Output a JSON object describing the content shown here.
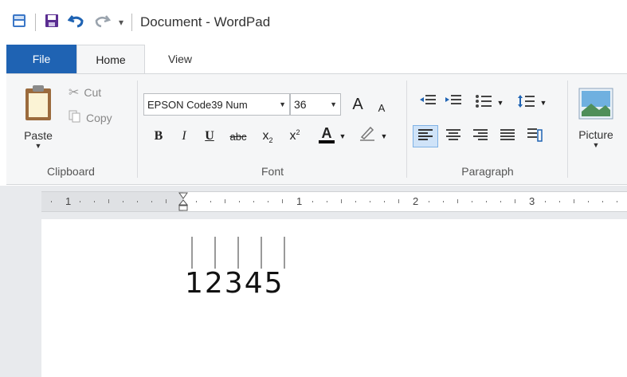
{
  "window": {
    "title": "Document - WordPad"
  },
  "tabs": {
    "file": "File",
    "home": "Home",
    "view": "View"
  },
  "clipboard": {
    "paste": "Paste",
    "cut": "Cut",
    "copy": "Copy",
    "group_label": "Clipboard"
  },
  "font": {
    "family": "EPSON Code39 Num",
    "size": "36",
    "group_label": "Font",
    "bold": "B",
    "italic": "I",
    "underline": "U",
    "strike": "abc",
    "subscript": "x",
    "superscript": "x",
    "grow": "A",
    "shrink": "A",
    "color_letter": "A"
  },
  "paragraph": {
    "group_label": "Paragraph"
  },
  "insert": {
    "picture": "Picture"
  },
  "ruler": {
    "marks": [
      "1",
      "1",
      "2",
      "3"
    ]
  },
  "document": {
    "content": "12345"
  },
  "colors": {
    "file_tab": "#1f63b3",
    "ribbon_bg": "#f5f6f7",
    "accent": "#1f63b3"
  }
}
